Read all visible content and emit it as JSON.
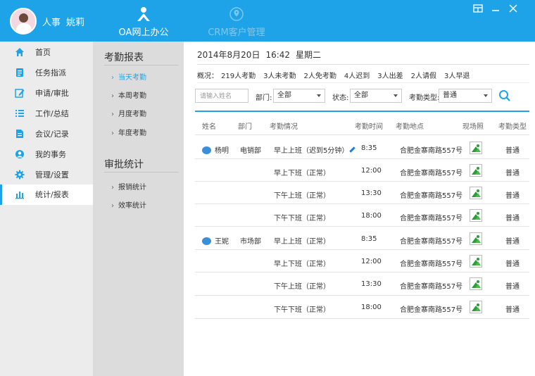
{
  "colors": {
    "brand": "#1fa3e8",
    "sidebar_bg": "#ececec",
    "subpanel_bg": "#dcdcdc"
  },
  "user": {
    "role": "人事",
    "name": "姚莉"
  },
  "top_tabs": [
    {
      "label": "OA网上办公",
      "icon": "oa-person-icon",
      "active": true
    },
    {
      "label": "CRM客户管理",
      "icon": "crm-location-icon",
      "active": false
    }
  ],
  "window_buttons": [
    "grid-icon",
    "minimize-icon",
    "close-icon"
  ],
  "sidebar": {
    "items": [
      {
        "label": "首页",
        "icon": "home-icon"
      },
      {
        "label": "任务指派",
        "icon": "task-icon"
      },
      {
        "label": "申请/审批",
        "icon": "edit-icon"
      },
      {
        "label": "工作/总结",
        "icon": "list-icon"
      },
      {
        "label": "会议/记录",
        "icon": "document-icon"
      },
      {
        "label": "我的事务",
        "icon": "user-icon"
      },
      {
        "label": "管理/设置",
        "icon": "gear-icon"
      },
      {
        "label": "统计/报表",
        "icon": "bar-chart-icon",
        "active": true
      }
    ]
  },
  "subpanel": {
    "section1": {
      "title": "考勤报表",
      "items": [
        "当天考勤",
        "本周考勤",
        "月度考勤",
        "年度考勤"
      ],
      "active": 0
    },
    "section2": {
      "title": "审批统计",
      "items": [
        "报销统计",
        "效率统计"
      ]
    }
  },
  "main": {
    "date": "2014年8月20日",
    "time": "16:42",
    "weekday": "星期二",
    "summary": {
      "label": "概况：",
      "items": [
        "219人考勤",
        "3人未考勤",
        "2人免考勤",
        "4人迟到",
        "3人出差",
        "2人请假",
        "3人早退"
      ]
    },
    "filters": {
      "name_placeholder": "请输入姓名",
      "dept_label": "部门:",
      "dept_value": "全部",
      "status_label": "状态:",
      "status_value": "全部",
      "type_label": "考勤类型:",
      "type_value": "普通"
    },
    "columns": [
      "姓名",
      "部门",
      "考勤情况",
      "考勤时间",
      "考勤地点",
      "现场照",
      "考勤类型"
    ],
    "rows": [
      {
        "name": "杨明",
        "dept": "电销部",
        "status": "早上上班（迟到5分钟）",
        "time": "8:35",
        "place": "合肥金寨南路557号",
        "type": "普通",
        "edit": true
      },
      {
        "name": "",
        "dept": "",
        "status": "早上下班（正常）",
        "time": "12:00",
        "place": "合肥金寨南路557号",
        "type": "普通"
      },
      {
        "name": "",
        "dept": "",
        "status": "下午上班（正常）",
        "time": "13:30",
        "place": "合肥金寨南路557号",
        "type": "普通"
      },
      {
        "name": "",
        "dept": "",
        "status": "下午下班（正常）",
        "time": "18:00",
        "place": "合肥金寨南路557号",
        "type": "普通"
      },
      {
        "name": "王妮",
        "dept": "市场部",
        "status": "早上上班（正常）",
        "time": "8:35",
        "place": "合肥金寨南路557号",
        "type": "普通"
      },
      {
        "name": "",
        "dept": "",
        "status": "早上下班（正常）",
        "time": "12:00",
        "place": "合肥金寨南路557号",
        "type": "普通"
      },
      {
        "name": "",
        "dept": "",
        "status": "下午上班（正常）",
        "time": "13:30",
        "place": "合肥金寨南路557号",
        "type": "普通"
      },
      {
        "name": "",
        "dept": "",
        "status": "下午下班（正常）",
        "time": "18:00",
        "place": "合肥金寨南路557号",
        "type": "普通"
      }
    ]
  }
}
